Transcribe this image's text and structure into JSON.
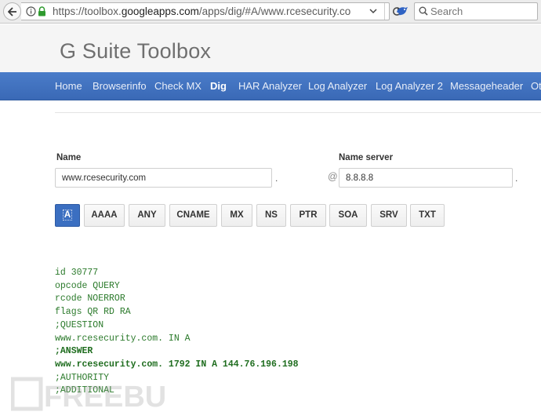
{
  "browser": {
    "url_prefix": "https://toolbox.",
    "url_host": "googleapps.com",
    "url_path": "/apps/dig/#A/www.rcesecurity.co",
    "search_placeholder": "Search"
  },
  "site": {
    "title": "G Suite Toolbox"
  },
  "nav": {
    "items": [
      {
        "label": "Home"
      },
      {
        "label": "Browserinfo"
      },
      {
        "label": "Check MX"
      },
      {
        "label": "Dig"
      },
      {
        "label": "HAR Analyzer"
      },
      {
        "label": "Log Analyzer"
      },
      {
        "label": "Log Analyzer 2"
      },
      {
        "label": "Messageheader"
      },
      {
        "label": "Ot"
      }
    ],
    "active": "Dig"
  },
  "form": {
    "name_label": "Name",
    "name_value": "www.rcesecurity.com",
    "name_suffix": ".",
    "server_label": "Name server",
    "server_prefix": "@",
    "server_value": "8.8.8.8",
    "server_suffix": "."
  },
  "record_types": {
    "items": [
      "A",
      "AAAA",
      "ANY",
      "CNAME",
      "MX",
      "NS",
      "PTR",
      "SOA",
      "SRV",
      "TXT"
    ],
    "active": "A"
  },
  "result": {
    "lines": [
      "id 30777",
      "opcode QUERY",
      "rcode NOERROR",
      "flags QR RD RA",
      ";QUESTION",
      "www.rcesecurity.com. IN A",
      ";ANSWER",
      "www.rcesecurity.com. 1792 IN A 144.76.196.198",
      ";AUTHORITY",
      ";ADDITIONAL"
    ],
    "bold_lines": [
      6,
      7
    ]
  },
  "watermark": {
    "text": "FREEBUF"
  },
  "colors": {
    "nav_bg": "#3f71be",
    "result_text": "#2b7a2b",
    "active_button": "#3b6fc1"
  }
}
